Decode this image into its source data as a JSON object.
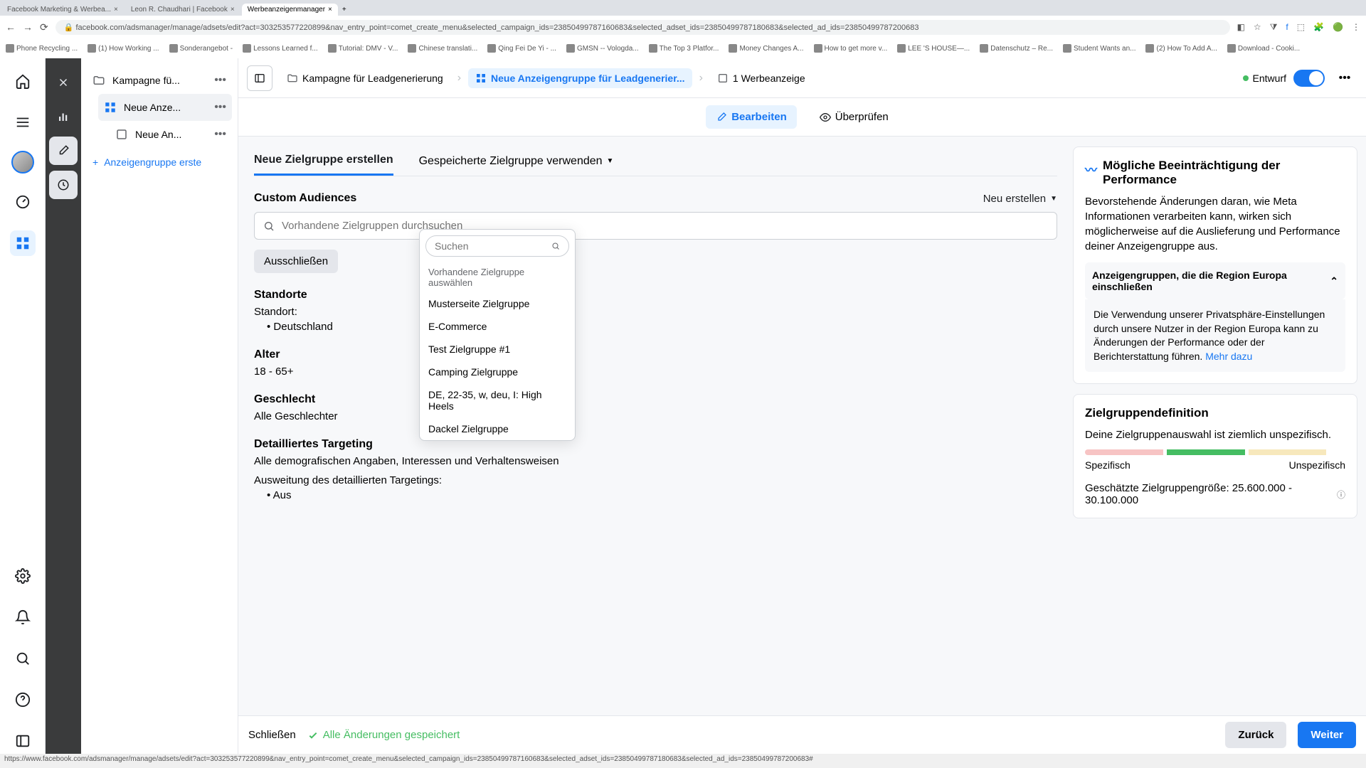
{
  "browser": {
    "tabs": [
      {
        "label": "Facebook Marketing & Werbea..."
      },
      {
        "label": "Leon R. Chaudhari | Facebook"
      },
      {
        "label": "Werbeanzeigenmanager"
      }
    ],
    "url": "facebook.com/adsmanager/manage/adsets/edit?act=303253577220899&nav_entry_point=comet_create_menu&selected_campaign_ids=23850499787160683&selected_adset_ids=23850499787180683&selected_ad_ids=23850499787200683",
    "bookmarks": [
      "Phone Recycling ...",
      "(1) How Working ...",
      "Sonderangebot -",
      "Lessons Learned f...",
      "Tutorial: DMV - V...",
      "Chinese translati...",
      "Qing Fei De Yi - ...",
      "GMSN -- Vologda...",
      "The Top 3 Platfor...",
      "Money Changes A...",
      "How to get more v...",
      "LEE 'S HOUSE—...",
      "Datenschutz – Re...",
      "Student Wants an...",
      "(2) How To Add A...",
      "Download - Cooki..."
    ]
  },
  "tree": {
    "campaign": "Kampagne fü...",
    "adset": "Neue Anze...",
    "ad": "Neue An...",
    "add": "Anzeigengruppe erste"
  },
  "breadcrumb": {
    "campaign": "Kampagne für Leadgenerierung",
    "adset": "Neue Anzeigengruppe für Leadgenerier...",
    "ad": "1 Werbeanzeige",
    "status": "Entwurf"
  },
  "mode": {
    "edit": "Bearbeiten",
    "review": "Überprüfen"
  },
  "tabs": {
    "new": "Neue Zielgruppe erstellen",
    "saved": "Gespeicherte Zielgruppe verwenden"
  },
  "custom": {
    "title": "Custom Audiences",
    "new": "Neu erstellen",
    "search_placeholder": "Vorhandene Zielgruppen durchsuchen",
    "exclude": "Ausschließen"
  },
  "dropdown": {
    "search_placeholder": "Suchen",
    "label": "Vorhandene Zielgruppe auswählen",
    "items": [
      "Musterseite Zielgruppe",
      "E-Commerce",
      "Test Zielgruppe #1",
      "Camping Zielgruppe",
      "DE, 22-35, w, deu, I: High Heels",
      "Dackel Zielgruppe"
    ]
  },
  "location": {
    "title": "Standorte",
    "label": "Standort:",
    "value": "Deutschland"
  },
  "age": {
    "title": "Alter",
    "value": "18 - 65+"
  },
  "gender": {
    "title": "Geschlecht",
    "value": "Alle Geschlechter"
  },
  "detailed": {
    "title": "Detailliertes Targeting",
    "value": "Alle demografischen Angaben, Interessen und Verhaltensweisen",
    "expansion_label": "Ausweitung des detaillierten Targetings:",
    "expansion_value": "Aus"
  },
  "perf_card": {
    "title": "Mögliche Beeinträchtigung der Performance",
    "text": "Bevorstehende Änderungen daran, wie Meta Informationen verarbeiten kann, wirken sich möglicherweise auf die Auslieferung und Performance deiner Anzeigengruppe aus.",
    "coll_title": "Anzeigengruppen, die die Region Europa einschließen",
    "coll_text": "Die Verwendung unserer Privatsphäre-Einstellungen durch unsere Nutzer in der Region Europa kann zu Änderungen der Performance oder der Berichterstattung führen. ",
    "more": "Mehr dazu"
  },
  "def_card": {
    "title": "Zielgruppendefinition",
    "text": "Deine Zielgruppenauswahl ist ziemlich unspezifisch.",
    "specific": "Spezifisch",
    "unspecific": "Unspezifisch",
    "est": "Geschätzte Zielgruppengröße: 25.600.000 - 30.100.000"
  },
  "footer": {
    "close": "Schließen",
    "saved": "Alle Änderungen gespeichert",
    "back": "Zurück",
    "next": "Weiter"
  },
  "status_url": "https://www.facebook.com/adsmanager/manage/adsets/edit?act=303253577220899&nav_entry_point=comet_create_menu&selected_campaign_ids=23850499787160683&selected_adset_ids=23850499787180683&selected_ad_ids=23850499787200683#"
}
